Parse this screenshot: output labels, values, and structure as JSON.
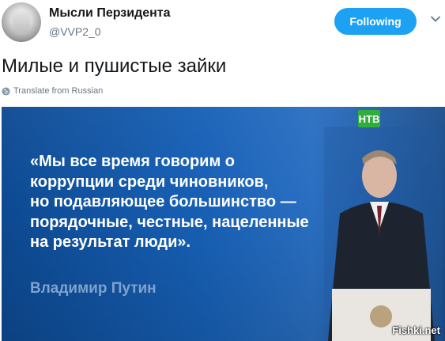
{
  "account": {
    "display_name": "Мысли Перзидента",
    "handle": "@VVP2_0"
  },
  "actions": {
    "follow_label": "Following"
  },
  "tweet": {
    "text": "Милые и пушистые зайки",
    "translate_label": "Translate from Russian"
  },
  "media": {
    "quote_lines": [
      "«Мы все время говорим о",
      "коррупции среди чиновников,",
      "но подавляющее большинство —",
      "порядочные, честные, нацеленные",
      "на результат люди»."
    ],
    "author": "Владимир Путин",
    "channel_logo": "НТВ",
    "watermark": "Fishki.net"
  },
  "icons": {
    "chevron": "chevron-down-icon",
    "globe": "globe-icon"
  },
  "colors": {
    "accent": "#1da1f2",
    "media_background": "#1760b6",
    "channel_green": "#2fae3c"
  }
}
